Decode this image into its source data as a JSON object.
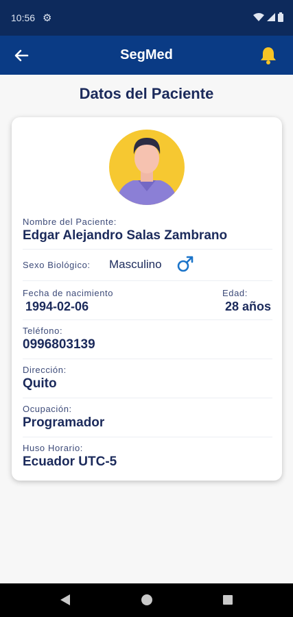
{
  "status_bar": {
    "time": "10:56",
    "icons": [
      "settings-gear-icon",
      "wifi-icon",
      "signal-icon",
      "battery-icon"
    ]
  },
  "app_bar": {
    "title": "SegMed",
    "back_icon": "arrow-left-icon",
    "notification_icon": "bell-icon",
    "notification_icon_color": "#f7c325"
  },
  "page": {
    "heading": "Datos del Paciente"
  },
  "patient": {
    "avatar_icon": "person-avatar",
    "name_label": "Nombre del Paciente:",
    "name_value": "Edgar Alejandro Salas Zambrano",
    "sex_label": "Sexo Biológico:",
    "sex_value": "Masculino",
    "sex_icon": "male-symbol-icon",
    "birth_label": "Fecha de nacimiento",
    "birth_value": "1994-02-06",
    "age_label": "Edad:",
    "age_value": "28 años",
    "phone_label": "Teléfono:",
    "phone_value": "0996803139",
    "address_label": "Dirección:",
    "address_value": "Quito",
    "occupation_label": "Ocupación:",
    "occupation_value": "Programador",
    "timezone_label": "Huso Horario:",
    "timezone_value": "Ecuador UTC-5"
  },
  "colors": {
    "app_bar": "#0a3b85",
    "status_bar": "#0d2a5c",
    "text_primary": "#1b2a5b",
    "male_icon": "#1b74c9",
    "avatar_bg": "#f6c831"
  },
  "nav_bar": {
    "icons": [
      "back-triangle-icon",
      "home-circle-icon",
      "recents-square-icon"
    ]
  }
}
